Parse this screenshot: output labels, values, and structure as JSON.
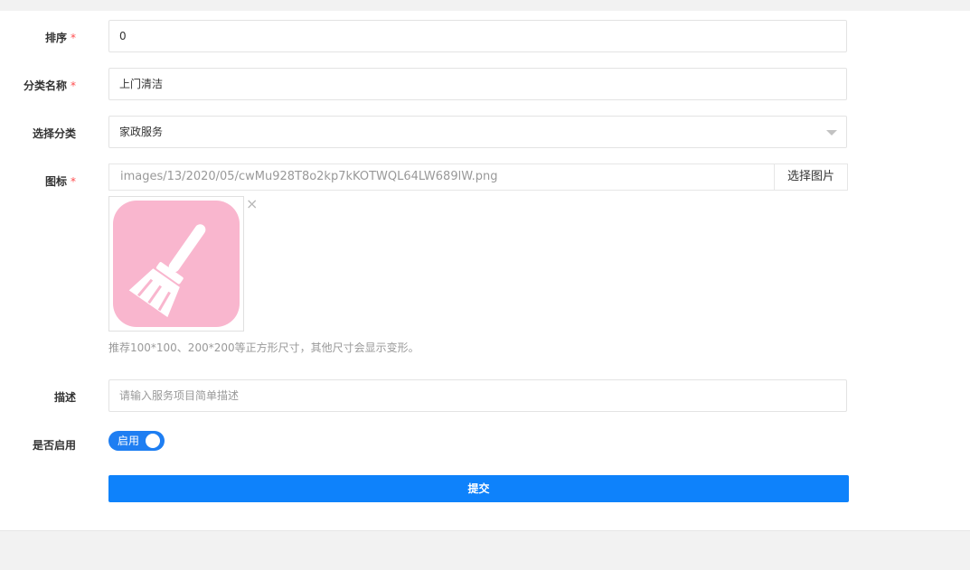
{
  "form": {
    "sort": {
      "label": "排序",
      "required_mark": "*",
      "value": "0"
    },
    "category_name": {
      "label": "分类名称",
      "required_mark": "*",
      "value": "上门清洁"
    },
    "parent_category": {
      "label": "选择分类",
      "selected": "家政服务",
      "icon": "chevron-down-icon"
    },
    "icon_field": {
      "label": "图标",
      "required_mark": "*",
      "path": "images/13/2020/05/cwMu928T8o2kp7kKOTWQL64LW689lW.png",
      "pick_button": "选择图片",
      "remove_glyph": "×",
      "preview_icon": "broom-icon",
      "preview_bg": "#f9b6ce",
      "hint": "推荐100*100、200*200等正方形尺寸，其他尺寸会显示变形。"
    },
    "description": {
      "label": "描述",
      "placeholder": "请输入服务项目简单描述"
    },
    "enabled": {
      "label": "是否启用",
      "toggle_text": "启用",
      "on": true
    },
    "submit_button": "提交"
  },
  "colors": {
    "primary": "#0e82fb",
    "toggle": "#1e7ef2",
    "required": "#ff4d4f",
    "page_bg": "#f2f2f2"
  }
}
